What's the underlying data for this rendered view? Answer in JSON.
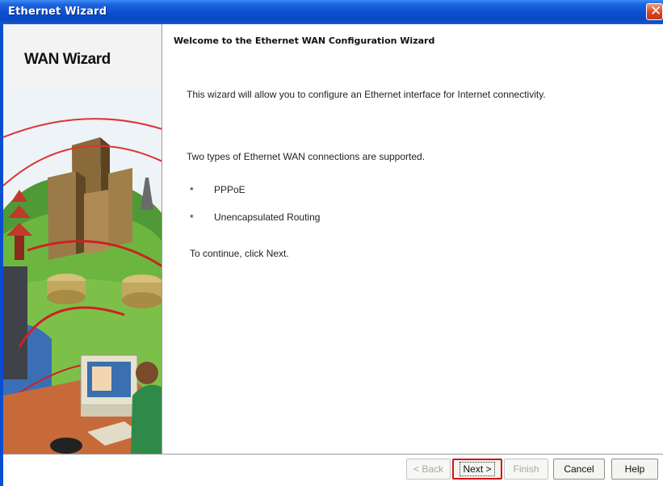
{
  "window": {
    "title": "Ethernet Wizard",
    "close_glyph": "✕"
  },
  "sidebar": {
    "title": "WAN Wizard",
    "illustration": "city-network-computer-illustration"
  },
  "main": {
    "heading": "Welcome to the Ethernet WAN Configuration Wizard",
    "intro": "This wizard will allow you to configure an Ethernet interface for Internet connectivity.",
    "types_intro": "Two types of Ethernet WAN connections are supported.",
    "bullets": [
      {
        "marker": "*",
        "text": "PPPoE"
      },
      {
        "marker": "*",
        "text": "Unencapsulated Routing"
      }
    ],
    "continue_text": "To continue, click Next."
  },
  "buttons": {
    "back": "< Back",
    "next": "Next >",
    "finish": "Finish",
    "cancel": "Cancel",
    "help": "Help"
  },
  "colors": {
    "titlebar": "#0a4ed0",
    "highlight": "#d21313",
    "close": "#d8441f"
  }
}
